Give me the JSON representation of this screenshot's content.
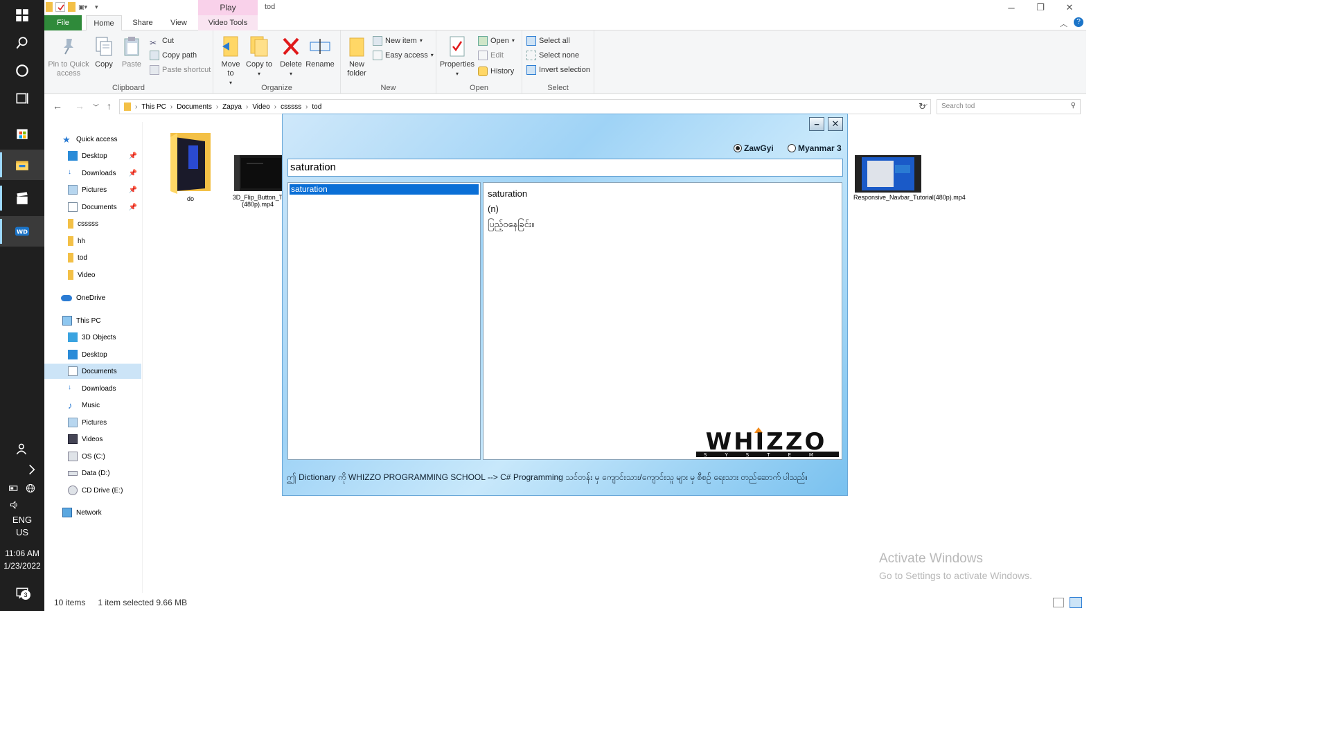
{
  "titlebar": {
    "play_label": "Play",
    "window_title": "tod"
  },
  "ribbon_tabs": {
    "file": "File",
    "home": "Home",
    "share": "Share",
    "view": "View",
    "video_tools": "Video Tools"
  },
  "ribbon": {
    "clipboard": {
      "pin_label": "Pin to Quick access",
      "copy_label": "Copy",
      "paste_label": "Paste",
      "cut_label": "Cut",
      "copy_path_label": "Copy path",
      "paste_shortcut_label": "Paste shortcut",
      "group_label": "Clipboard"
    },
    "organize": {
      "move_to_label": "Move to",
      "copy_to_label": "Copy to",
      "delete_label": "Delete",
      "rename_label": "Rename",
      "group_label": "Organize"
    },
    "new": {
      "new_folder_label": "New folder",
      "new_item_label": "New item",
      "easy_access_label": "Easy access",
      "group_label": "New"
    },
    "open": {
      "properties_label": "Properties",
      "open_label": "Open",
      "edit_label": "Edit",
      "history_label": "History",
      "group_label": "Open"
    },
    "select": {
      "select_all_label": "Select all",
      "select_none_label": "Select none",
      "invert_label": "Invert selection",
      "group_label": "Select"
    }
  },
  "address": {
    "crumbs": [
      "This PC",
      "Documents",
      "Zapya",
      "Video",
      "csssss",
      "tod"
    ],
    "search_placeholder": "Search tod"
  },
  "navpane": {
    "quick_access": "Quick access",
    "desktop": "Desktop",
    "downloads": "Downloads",
    "pictures": "Pictures",
    "documents": "Documents",
    "csssss": "csssss",
    "hh": "hh",
    "tod": "tod",
    "video": "Video",
    "onedrive": "OneDrive",
    "this_pc": "This PC",
    "objects3d": "3D Objects",
    "desktop2": "Desktop",
    "documents2": "Documents",
    "downloads2": "Downloads",
    "music": "Music",
    "pictures2": "Pictures",
    "videos": "Videos",
    "os_c": "OS (C:)",
    "data_d": "Data (D:)",
    "cd_e": "CD Drive (E:)",
    "network": "Network"
  },
  "files": {
    "folder_do": "do",
    "flip_video": "3D_Flip_Button_T (480p).mp4",
    "navbar_video": "Responsive_Navbar_Tutorial(480p).mp4"
  },
  "status": {
    "items": "10 items",
    "selected": "1 item selected  9.66 MB"
  },
  "watermark": {
    "line1": "Activate Windows",
    "line2": "Go to Settings to activate Windows."
  },
  "taskbar": {
    "lang1": "ENG",
    "lang2": "US",
    "time": "11:06 AM",
    "date": "1/23/2022",
    "notif_count": "3"
  },
  "dictionary": {
    "minimize": "−",
    "close": "✕",
    "radio_zawgyi": "ZawGyi",
    "radio_myanmar3": "Myanmar 3",
    "search_value": "saturation",
    "results": [
      "saturation"
    ],
    "def_word": "saturation",
    "def_pos": "(n)",
    "def_meaning": "ပြည့်ဝနေခြင်း။",
    "logo_text": "WHIZZO",
    "logo_sub": "SYSTEM",
    "footer": "ဤ Dictionary ကို WHIZZO PROGRAMMING SCHOOL --> C# Programming သင်တန်း မှ ကျောင်းသား/ကျောင်းသူ များ မှ စီစဉ် ရေးသား တည်ဆောက် ပါသည်။"
  },
  "colors": {
    "file_tab": "#2f8a3a",
    "selection": "#0a6fd6",
    "video_tools_tab": "#f9d1ea"
  }
}
